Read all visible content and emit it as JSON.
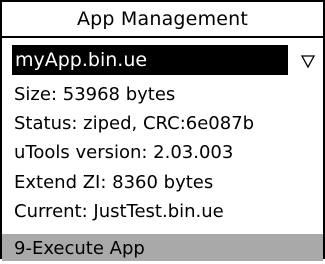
{
  "screen": {
    "title": "App Management"
  },
  "app_select": {
    "value": "myApp.bin.ue",
    "arrow_icon": "down-triangle-icon"
  },
  "info": {
    "size": "Size: 53968 bytes",
    "status": "Status: ziped, CRC:6e087b",
    "utools_version": "uTools version: 2.03.003",
    "extend_zi": "Extend ZI: 8360 bytes",
    "current": "Current: JustTest.bin.ue"
  },
  "menu": {
    "selected_item": "9-Execute App",
    "highlight_color": "#a9a9a9"
  }
}
